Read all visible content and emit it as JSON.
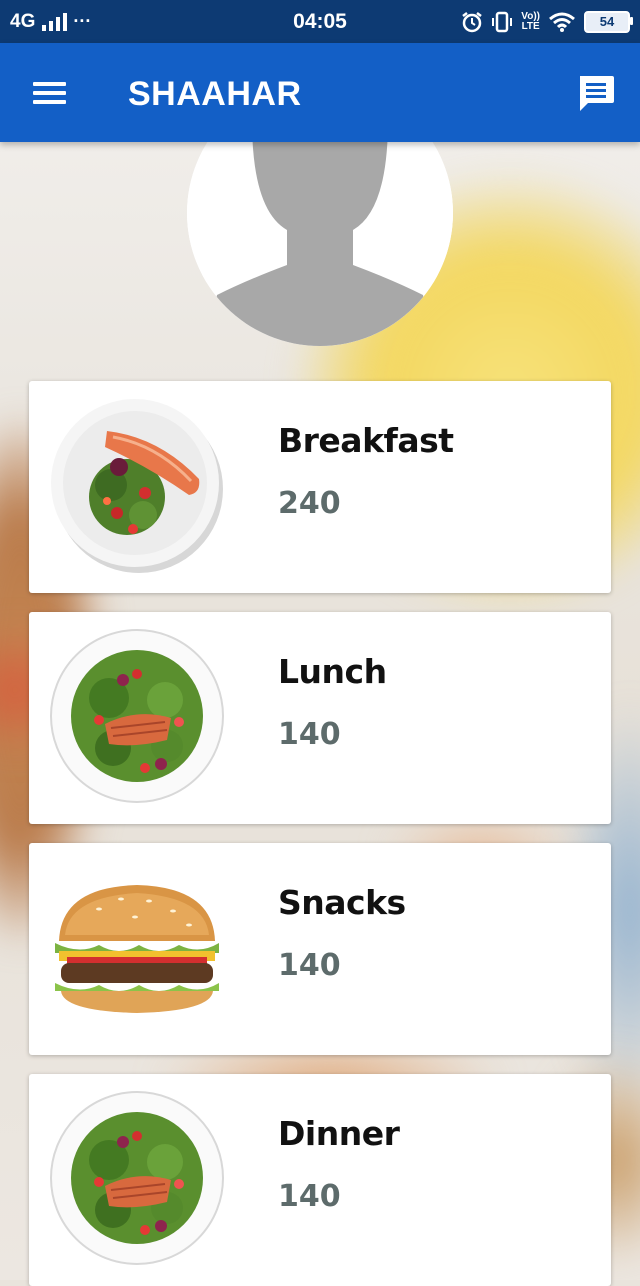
{
  "status_bar": {
    "network": "4G",
    "more": "···",
    "time": "04:05",
    "volte_top": "Vo))",
    "volte_bottom": "LTE",
    "battery": "54"
  },
  "app_bar": {
    "title": "SHAAHAR",
    "menu_icon": "hamburger-menu-icon",
    "chat_icon": "chat-message-icon",
    "color": "#135fc6"
  },
  "profile": {
    "avatar_icon": "person-silhouette-icon"
  },
  "meals": [
    {
      "label": "Breakfast",
      "value": "240",
      "image": "salmon-salad-plate"
    },
    {
      "label": "Lunch",
      "value": "140",
      "image": "salmon-salad-bowl"
    },
    {
      "label": "Snacks",
      "value": "140",
      "image": "burger"
    },
    {
      "label": "Dinner",
      "value": "140",
      "image": "salmon-salad-bowl"
    }
  ]
}
